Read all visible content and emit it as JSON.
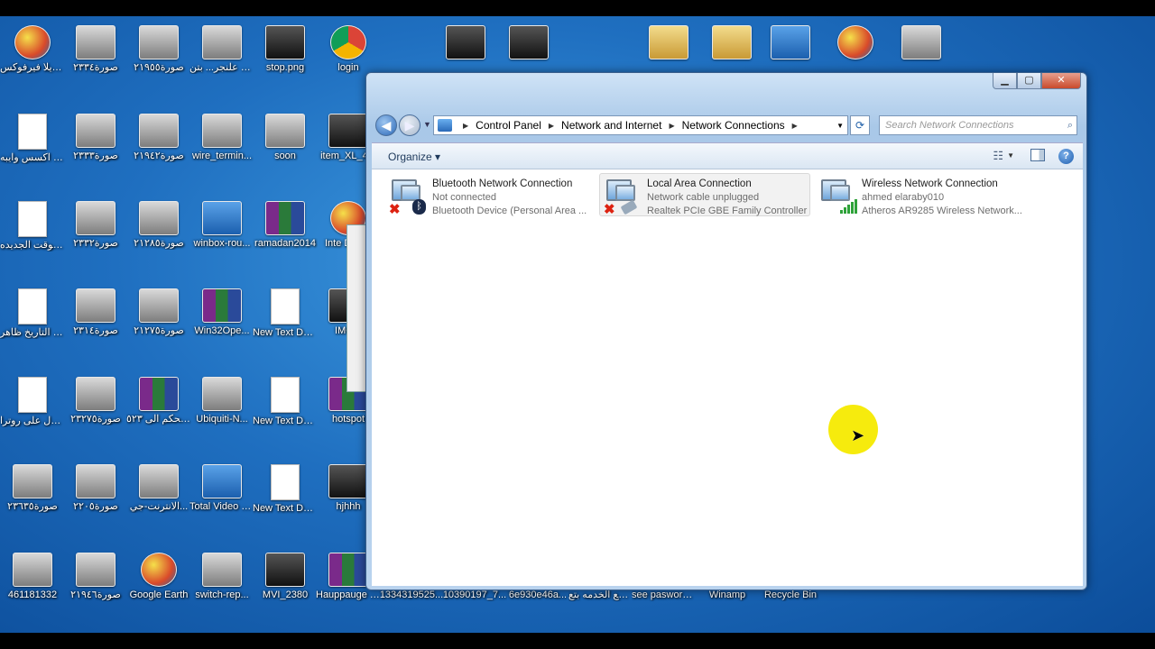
{
  "desktop_icons": [
    {
      "label": "موزيلا فيرفوكس",
      "icon": "firefox-icon",
      "kind": "globe"
    },
    {
      "label": "صورة٢٣٣٤",
      "icon": "image-icon",
      "kind": "img"
    },
    {
      "label": "صورة٢١٩٥٥",
      "icon": "image-icon",
      "kind": "img"
    },
    {
      "label": "إعدادات الراوتر علنجر... بتن",
      "icon": "image-icon",
      "kind": "img"
    },
    {
      "label": "stop.png",
      "icon": "image-icon",
      "kind": "dark"
    },
    {
      "label": "login",
      "icon": "chrome-icon",
      "kind": "chrome"
    },
    {
      "label": "كود برمجة اكسس وايبه...",
      "icon": "text-file-icon",
      "kind": "doc"
    },
    {
      "label": "صورة٢٣٣٣",
      "icon": "image-icon",
      "kind": "img"
    },
    {
      "label": "صورة٢١٩٤٢",
      "icon": "image-icon",
      "kind": "img"
    },
    {
      "label": "wire_termin...",
      "icon": "image-icon",
      "kind": "img"
    },
    {
      "label": "soon",
      "icon": "image-icon",
      "kind": "img"
    },
    {
      "label": "item_XL_4...",
      "icon": "image-icon",
      "kind": "dark"
    },
    {
      "label": "كلمه تظبيط الوقت الجديده",
      "icon": "text-file-icon",
      "kind": "doc"
    },
    {
      "label": "صورة٢٣٣٢",
      "icon": "image-icon",
      "kind": "img"
    },
    {
      "label": "صورة٢١٢٨٥",
      "icon": "image-icon",
      "kind": "img"
    },
    {
      "label": "winbox-rou...",
      "icon": "image-icon",
      "kind": "blue"
    },
    {
      "label": "ramadan2014",
      "icon": "winrar-icon",
      "kind": "rar"
    },
    {
      "label": "Inte Dow...",
      "icon": "globe-icon",
      "kind": "globe"
    },
    {
      "label": "ضبط التاريخ ظاهر",
      "icon": "text-file-icon",
      "kind": "doc"
    },
    {
      "label": "صورة٢٣١٤",
      "icon": "image-icon",
      "kind": "img"
    },
    {
      "label": "صورة٢١٢٧٥",
      "icon": "image-icon",
      "kind": "img"
    },
    {
      "label": "Win32Ope...",
      "icon": "winrar-icon",
      "kind": "rar"
    },
    {
      "label": "New Text Document",
      "icon": "text-file-icon",
      "kind": "doc"
    },
    {
      "label": "IMG...",
      "icon": "image-icon",
      "kind": "dark"
    },
    {
      "label": "كيفية الدخول على روترا...",
      "icon": "text-file-icon",
      "kind": "doc"
    },
    {
      "label": "صورة٢٣٢٧٥",
      "icon": "image-icon",
      "kind": "img"
    },
    {
      "label": "تركيبه بورده التحكم الى ٥٢٣",
      "icon": "winrar-icon",
      "kind": "rar"
    },
    {
      "label": "Ubiquiti-N...",
      "icon": "image-icon",
      "kind": "img"
    },
    {
      "label": "New Text Docume...",
      "icon": "text-file-icon",
      "kind": "doc"
    },
    {
      "label": "hotspot",
      "icon": "winrar-icon",
      "kind": "rar"
    },
    {
      "label": "صورة٢٣٦٣٥",
      "icon": "image-icon",
      "kind": "img"
    },
    {
      "label": "صورة٢٢٠٥",
      "icon": "image-icon",
      "kind": "img"
    },
    {
      "label": "الانترنت-جي...",
      "icon": "image-icon",
      "kind": "img"
    },
    {
      "label": "Total Video Converter",
      "icon": "video-converter-icon",
      "kind": "blue"
    },
    {
      "label": "New Text Docume...",
      "icon": "text-file-icon",
      "kind": "doc"
    },
    {
      "label": "hjhhh",
      "icon": "image-icon",
      "kind": "dark"
    },
    {
      "label": "461181332",
      "icon": "image-icon",
      "kind": "img"
    },
    {
      "label": "صورة٢١٩٤٦",
      "icon": "image-icon",
      "kind": "img"
    },
    {
      "label": "Google Earth",
      "icon": "google-earth-icon",
      "kind": "globe"
    },
    {
      "label": "switch-rep...",
      "icon": "image-icon",
      "kind": "img"
    },
    {
      "label": "MVI_2380",
      "icon": "video-file-icon",
      "kind": "dark"
    },
    {
      "label": "Hauppauge Tuner Win...",
      "icon": "winrar-icon",
      "kind": "rar"
    },
    {
      "label": "1334319525...",
      "icon": "image-icon",
      "kind": "dark"
    },
    {
      "label": "10390197_7...",
      "icon": "image-icon",
      "kind": "dark"
    },
    {
      "label": "6e930e46a...",
      "icon": "image-icon",
      "kind": "dark"
    },
    {
      "label": "صفحه قطع الخدمه بتع",
      "icon": "folder-icon",
      "kind": "folder"
    },
    {
      "label": "see paswored.v...",
      "icon": "folder-icon",
      "kind": "folder"
    },
    {
      "label": "Winamp",
      "icon": "winamp-icon",
      "kind": "dark"
    },
    {
      "label": "Recycle Bin",
      "icon": "recycle-bin-icon",
      "kind": "img"
    },
    {
      "label": "",
      "icon": "image-icon",
      "kind": "dark"
    },
    {
      "label": "",
      "icon": "image-icon",
      "kind": "dark"
    },
    {
      "label": "",
      "icon": "folder-icon",
      "kind": "folder"
    },
    {
      "label": "",
      "icon": "folder-icon",
      "kind": "folder"
    },
    {
      "label": "",
      "icon": "teamviewer-icon",
      "kind": "blue"
    },
    {
      "label": "",
      "icon": "network-icon",
      "kind": "globe"
    },
    {
      "label": "",
      "icon": "image-icon",
      "kind": "img"
    },
    {
      "label": "",
      "icon": "app-icon",
      "kind": "globe"
    }
  ],
  "window": {
    "caption_buttons": {
      "minimize": "▁",
      "maximize": "▢",
      "close": "✕"
    },
    "breadcrumb": [
      "Control Panel",
      "Network and Internet",
      "Network Connections"
    ],
    "search_placeholder": "Search Network Connections",
    "toolbar": {
      "organize": "Organize"
    },
    "connections": [
      {
        "name": "Bluetooth Network Connection",
        "status": "Not connected",
        "device": "Bluetooth Device (Personal Area ...",
        "badge": "bluetooth",
        "disconnected": true
      },
      {
        "name": "Local Area Connection",
        "status": "Network cable unplugged",
        "device": "Realtek PCIe GBE Family Controller",
        "badge": "cable",
        "disconnected": true,
        "selected": true
      },
      {
        "name": "Wireless Network Connection",
        "status": "ahmed elaraby010",
        "device": "Atheros AR9285 Wireless Network...",
        "badge": "signal",
        "disconnected": false
      }
    ]
  },
  "colors": {
    "desktop": "#1f6fc0",
    "highlight": "#f5ea00",
    "window_frame": "#a9c8e8"
  }
}
